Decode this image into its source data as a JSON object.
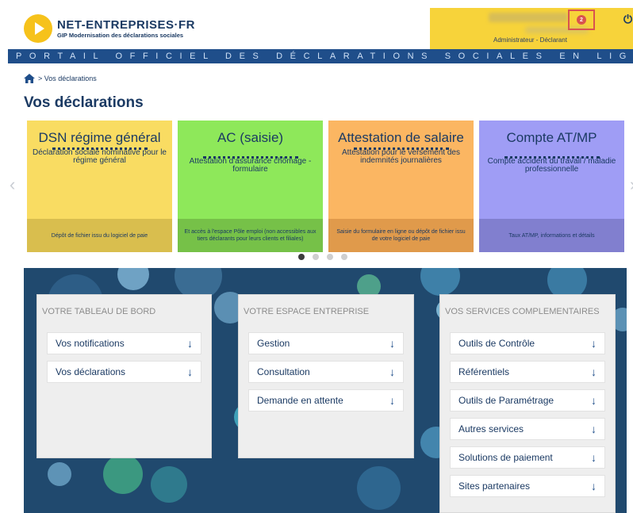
{
  "header": {
    "logo_name": "NET-ENTREPRISES·FR",
    "logo_sub": "GIP Modernisation des déclarations sociales",
    "user_role": "Administrateur - Déclarant",
    "notification_count": "2",
    "power_icon": "power-icon",
    "banner": "PORTAIL OFFICIEL DES DÉCLARATIONS SOCIALES EN LIGNE"
  },
  "breadcrumb": {
    "current": "> Vos déclarations"
  },
  "page": {
    "title": "Vos déclarations"
  },
  "cards": [
    {
      "title": "DSN régime général",
      "desc": "Déclaration sociale nominative pour le régime général",
      "footer": "Dépôt de fichier issu du logiciel de paie"
    },
    {
      "title": "AC (saisie)",
      "desc": "Attestation d'assurance chômage - formulaire",
      "footer": "Et accès à l'espace Pôle emploi (non accessibles aux tiers déclarants pour leurs clients et filiales)"
    },
    {
      "title": "Attestation de salaire",
      "desc": "Attestation pour le versement des indemnités journalières",
      "footer": "Saisie du formulaire en ligne ou dépôt de fichier issu de votre logiciel de paie"
    },
    {
      "title": "Compte AT/MP",
      "desc": "Compte accident du travail / maladie professionnelle",
      "footer": "Taux AT/MP, informations et détails"
    }
  ],
  "carousel": {
    "active_page": 1,
    "page_count": 4
  },
  "panels": {
    "tableau": {
      "title": "Votre tableau de bord",
      "items": [
        "Vos notifications",
        "Vos déclarations"
      ]
    },
    "entreprise": {
      "title": "Votre espace entreprise",
      "items": [
        "Gestion",
        "Consultation",
        "Demande en attente"
      ]
    },
    "services": {
      "title": "Vos services complementaires",
      "items": [
        "Outils de Contrôle",
        "Référentiels",
        "Outils de Paramétrage",
        "Autres services",
        "Solutions de paiement",
        "Sites partenaires"
      ]
    }
  },
  "colors": {
    "brand_blue": "#1f4e8a",
    "brand_yellow": "#f7d33a",
    "dashboard_bg": "#20496e"
  }
}
